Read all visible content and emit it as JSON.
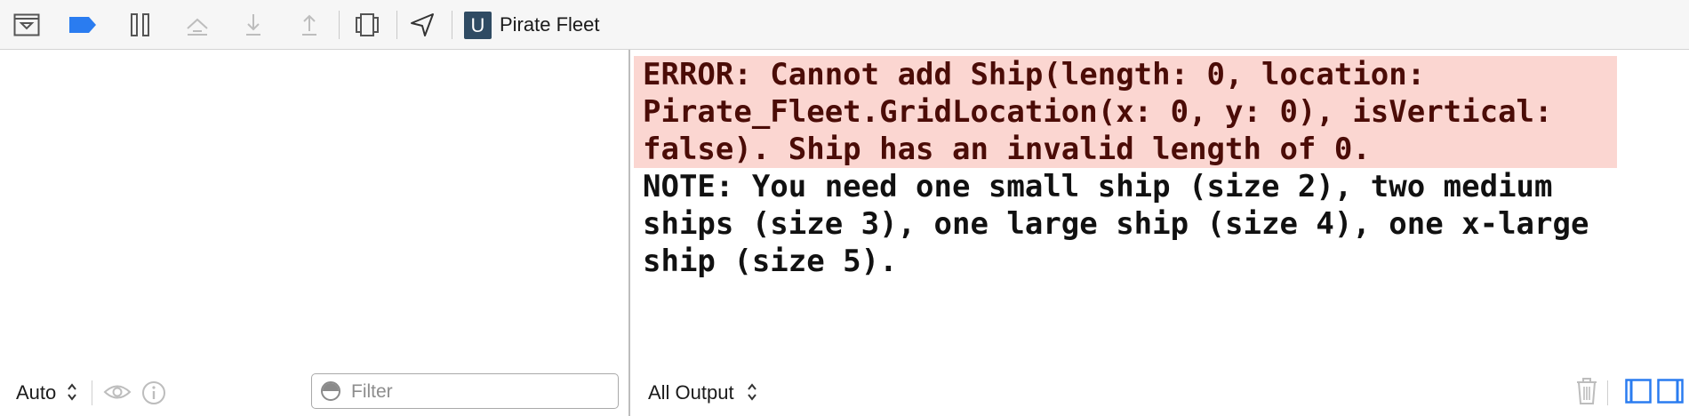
{
  "toolbar": {
    "scheme_letter": "U",
    "scheme_name": "Pirate Fleet",
    "accent": "#2a7cf0"
  },
  "console": {
    "error_lines": [
      "ERROR: Cannot add Ship(length: 0, location:",
      "Pirate_Fleet.GridLocation(x: 0, y: 0), isVertical:",
      "false). Ship has an invalid length of 0."
    ],
    "note_lines": [
      "NOTE: You need one small ship (size 2), two medium",
      "ships (size 3), one large ship (size 4), one x-large",
      "ship (size 5)."
    ]
  },
  "variables": {
    "scope_value": "Auto",
    "filter_placeholder": "Filter"
  },
  "output": {
    "scope_value": "All Output"
  }
}
